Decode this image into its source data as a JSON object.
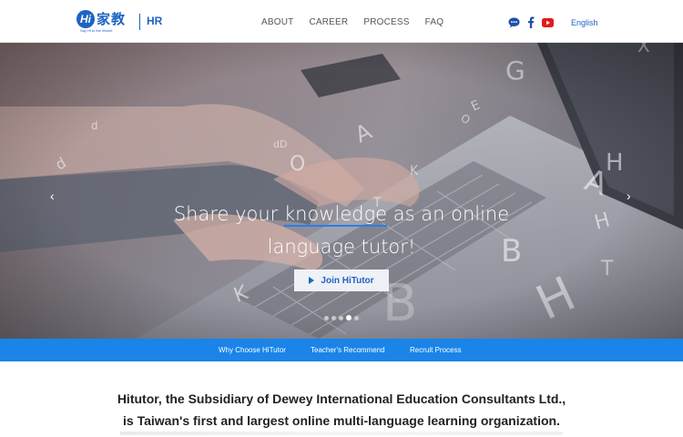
{
  "brand": {
    "logo_badge": "Hi",
    "logo_text": "家教",
    "tagline": "Say Hi to the World!",
    "section": "HR",
    "color": "#1e63c4"
  },
  "nav": {
    "items": [
      "ABOUT",
      "CAREER",
      "PROCESS",
      "FAQ"
    ]
  },
  "social": {
    "icons": [
      "chat-bubble-icon",
      "facebook-icon",
      "youtube-icon"
    ]
  },
  "language": "English",
  "hero": {
    "title_pre": "Share your ",
    "title_highlight": "knowledge",
    "title_post": " as an online language tutor!",
    "button": "Join HiTutor",
    "slide_count": 5,
    "active_slide": 4
  },
  "subnav": {
    "items": [
      "Why Choose HiTutor",
      "Teacher's Recommend",
      "Recruit Process"
    ],
    "color": "#1a84e8"
  },
  "intro": {
    "line1": "Hitutor, the Subsidiary of Dewey International Education Consultants Ltd.,",
    "line2": "is Taiwan's first and largest online multi-language learning organization."
  }
}
